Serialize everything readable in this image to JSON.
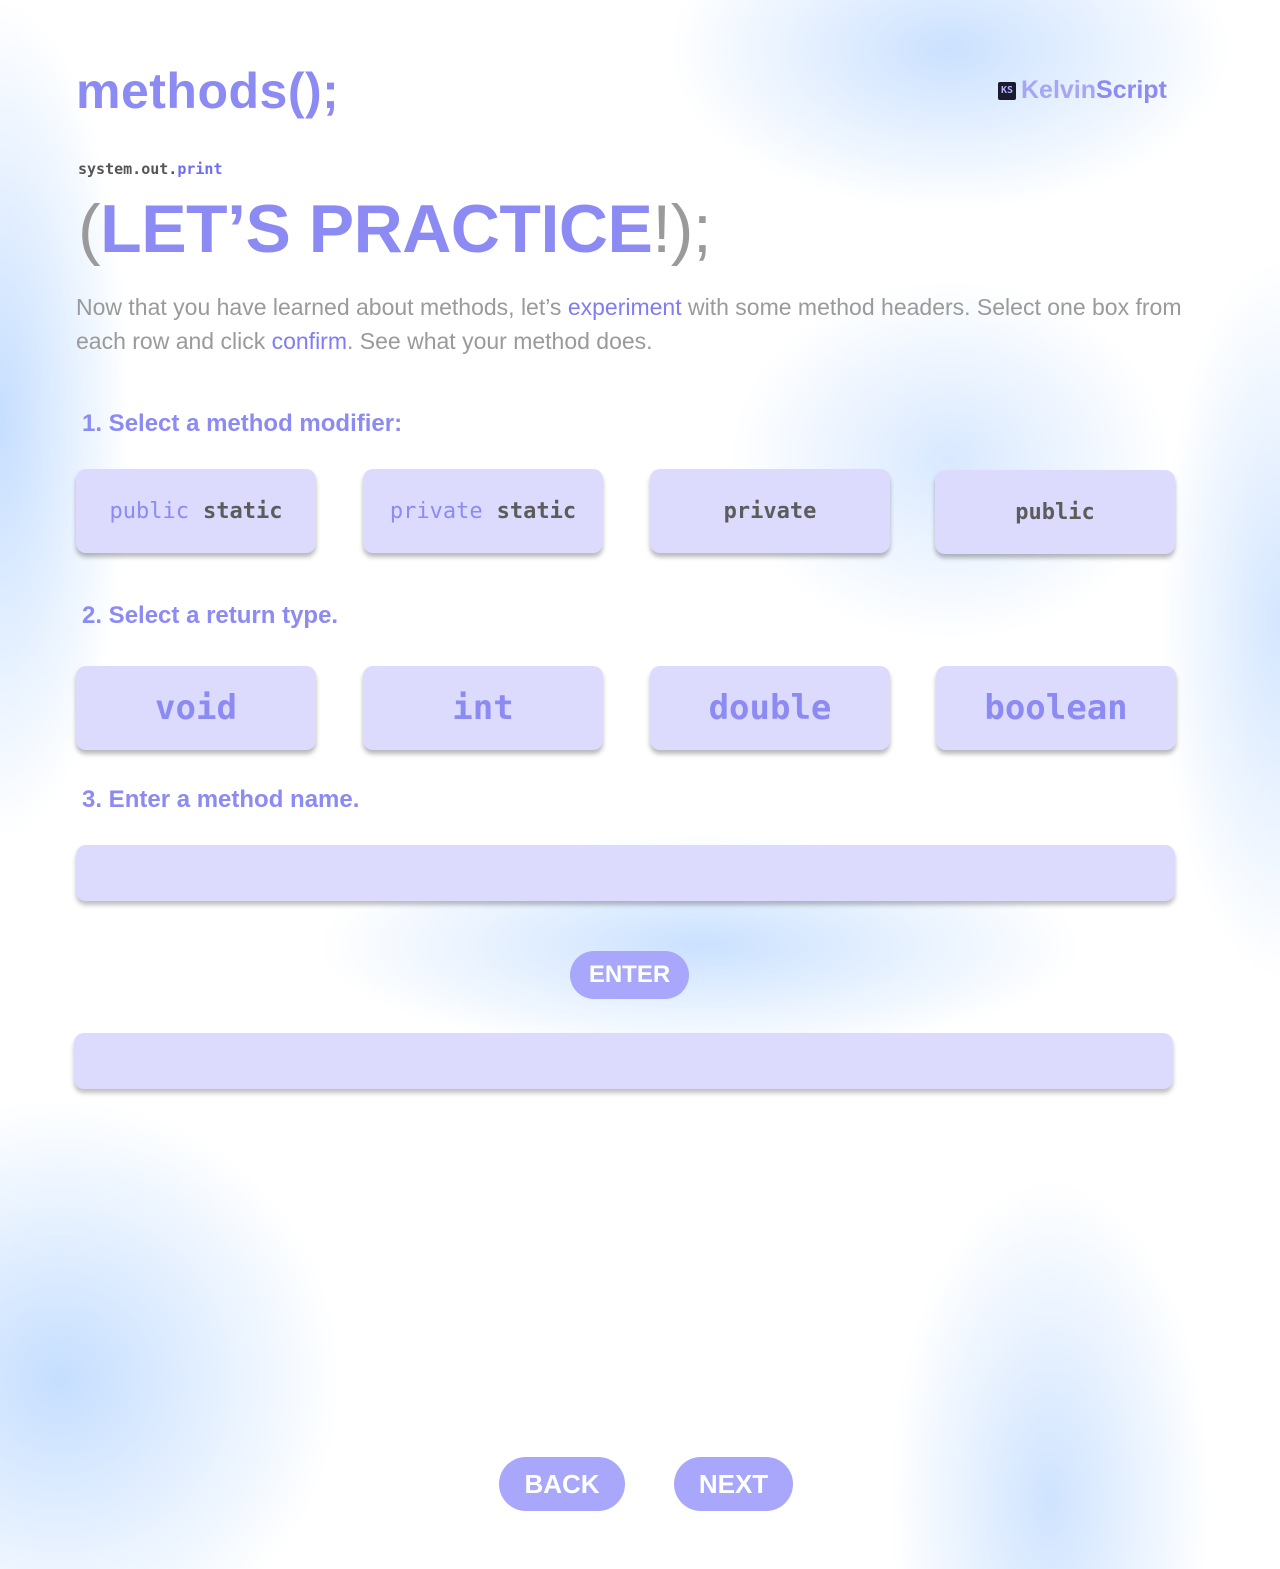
{
  "header": {
    "title": "methods();",
    "brand": {
      "logo_text": "KS",
      "name_part1": "Kelvin",
      "name_part2": "Script"
    }
  },
  "hero": {
    "kicker_prefix": "system.out.",
    "kicker_method": "print",
    "open_paren": "(",
    "title": "LET’S PRACTICE",
    "close": "!);"
  },
  "intro": {
    "part1": "Now that you have learned about methods, let’s ",
    "link1": "experiment",
    "part2": " with some method headers. Select one box from each row and click ",
    "link2": "confirm",
    "part3": ". See what your method does."
  },
  "step1": {
    "label": "1. Select a method modifier:",
    "options": [
      {
        "keyword": "public",
        "rest": "static"
      },
      {
        "keyword": "private",
        "rest": "static"
      },
      {
        "keyword": "",
        "rest": "private"
      },
      {
        "keyword": "",
        "rest": "public"
      }
    ]
  },
  "step2": {
    "label": "2. Select a return type.",
    "options": [
      "void",
      "int",
      "double",
      "boolean"
    ]
  },
  "step3": {
    "label": "3. Enter a method name.",
    "input_value": "",
    "enter_label": "ENTER"
  },
  "output": {
    "value": ""
  },
  "nav": {
    "back_label": "BACK",
    "next_label": "NEXT"
  },
  "colors": {
    "accent": "#8c8af3",
    "option_bg": "#dcdbfd",
    "button_bg": "#a8a7fb",
    "body_text": "#9a9a9a"
  }
}
